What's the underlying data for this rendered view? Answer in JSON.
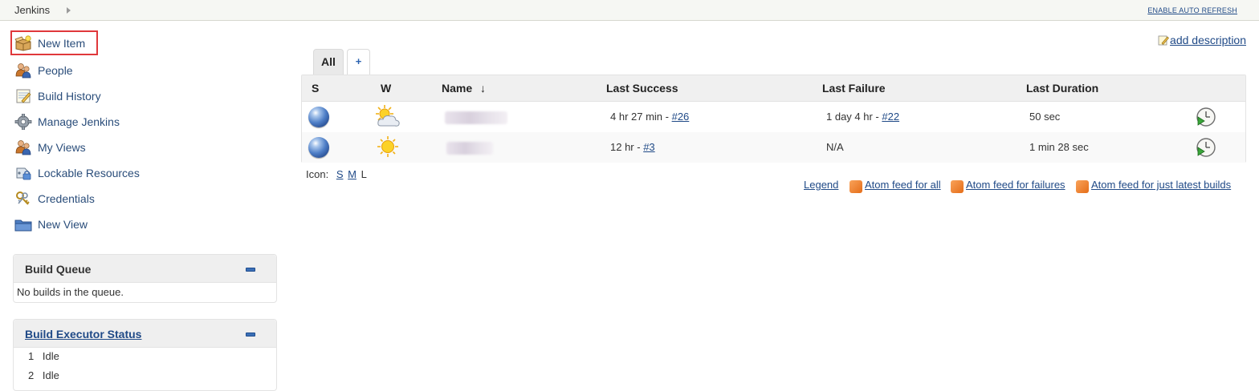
{
  "header": {
    "breadcrumb": "Jenkins",
    "auto_refresh": "ENABLE AUTO REFRESH"
  },
  "sidebar": {
    "tasks": [
      {
        "label": "New Item",
        "icon": "new-item-icon"
      },
      {
        "label": "People",
        "icon": "people-icon"
      },
      {
        "label": "Build History",
        "icon": "build-history-icon"
      },
      {
        "label": "Manage Jenkins",
        "icon": "gear-icon"
      },
      {
        "label": "My Views",
        "icon": "people-icon"
      },
      {
        "label": "Lockable Resources",
        "icon": "lockable-resources-icon"
      },
      {
        "label": "Credentials",
        "icon": "keys-icon"
      },
      {
        "label": "New View",
        "icon": "folder-icon"
      }
    ],
    "build_queue": {
      "title": "Build Queue",
      "empty_text": "No builds in the queue."
    },
    "executors": {
      "title": "Build Executor Status",
      "items": [
        {
          "number": "1",
          "status": "Idle"
        },
        {
          "number": "2",
          "status": "Idle"
        }
      ]
    }
  },
  "main": {
    "add_description": "add description",
    "tabs": [
      {
        "label": "All",
        "active": true
      },
      {
        "label": "+",
        "active": false
      }
    ],
    "table": {
      "columns": [
        "S",
        "W",
        "Name",
        "Last Success",
        "Last Failure",
        "Last Duration"
      ],
      "sort_indicator": "↓",
      "rows": [
        {
          "status": "blue",
          "weather": "partly-cloudy",
          "last_success_text": "4 hr 27 min - ",
          "last_success_link": "#26",
          "last_failure_text": "1 day 4 hr - ",
          "last_failure_link": "#22",
          "last_duration": "50 sec"
        },
        {
          "status": "blue",
          "weather": "sunny",
          "last_success_text": "12 hr - ",
          "last_success_link": "#3",
          "last_failure_text": "N/A",
          "last_failure_link": "",
          "last_duration": "1 min 28 sec"
        }
      ]
    },
    "icon_size": {
      "label": "Icon:",
      "options": [
        "S",
        "M",
        "L"
      ],
      "current": "L"
    },
    "footer_links": {
      "legend": "Legend",
      "feed_all": "Atom feed for all",
      "feed_failures": "Atom feed for failures",
      "feed_latest": "Atom feed for just latest builds"
    }
  },
  "colors": {
    "link": "#204a87",
    "highlight_border": "#e0383b",
    "status_blue": "#4f7fc7",
    "rss_orange": "#f28a2e"
  }
}
